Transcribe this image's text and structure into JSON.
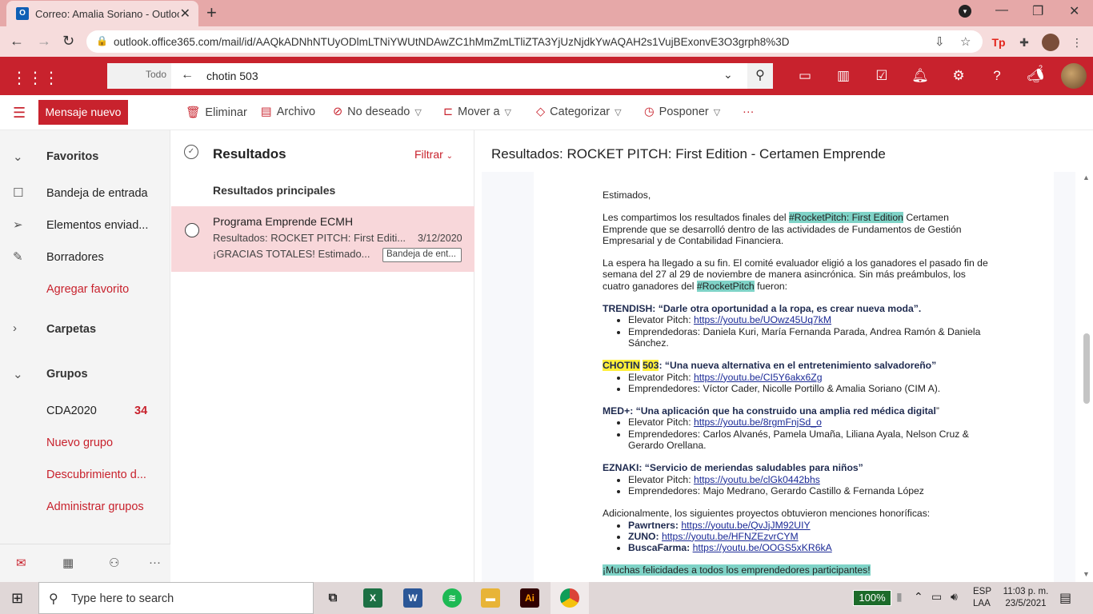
{
  "browser": {
    "tab_title": "Correo: Amalia Soriano - Outlook",
    "url": "outlook.office365.com/mail/id/AAQkADNhNTUyODlmLTNiYWUtNDAwZC1hMmZmLTliZTA3YjUzNjdkYwAQAH2s1VujBExonvE3O3grph8%3D"
  },
  "outlook": {
    "search_scope": "Todo",
    "search_query": "chotin 503",
    "new_message": "Mensaje nuevo",
    "commands": {
      "delete": "Eliminar",
      "archive": "Archivo",
      "junk": "No deseado",
      "move": "Mover a",
      "categorize": "Categorizar",
      "snooze": "Posponer",
      "more": "···"
    },
    "notification_count": "2"
  },
  "nav": {
    "favorites": "Favoritos",
    "inbox": "Bandeja de entrada",
    "sent": "Elementos enviad...",
    "drafts": "Borradores",
    "add_favorite": "Agregar favorito",
    "folders": "Carpetas",
    "groups": "Grupos",
    "group1": "CDA2020",
    "group1_count": "34",
    "new_group": "Nuevo grupo",
    "discover": "Descubrimiento d...",
    "manage": "Administrar grupos"
  },
  "list": {
    "title": "Resultados",
    "filter": "Filtrar",
    "section": "Resultados principales",
    "item": {
      "from": "Programa Emprende ECMH",
      "subject": "Resultados: ROCKET PITCH: First Editi...",
      "date": "3/12/2020",
      "preview": "¡GRACIAS TOTALES! Estimado...",
      "folder": "Bandeja de ent..."
    }
  },
  "reading": {
    "title": "Resultados: ROCKET PITCH: First Edition - Certamen Emprende",
    "greeting": "Estimados,",
    "p1_a": "Les compartimos los resultados finales del ",
    "p1_hl": "#RocketPitch: First Edition",
    "p1_b": " Certamen Emprende que se desarrolló dentro de las actividades de Fundamentos de Gestión Empresarial y de Contabilidad Financiera.",
    "p2_a": "La espera ha llegado a su fin. El comité evaluador eligió a los ganadores el pasado fin de semana del 27 al 29 de noviembre de manera asincrónica. Sin más preámbulos, los cuatro ganadores del ",
    "p2_hl": "#RocketPitch",
    "p2_b": " fueron:",
    "w1_title": "TRENDISH: “Darle otra oportunidad a la ropa, es crear nueva moda”.",
    "w1_pitch_label": "Elevator Pitch: ",
    "w1_pitch_url": "https://youtu.be/UOwz45Uq7kM",
    "w1_team": "Emprendedoras: Daniela Kuri, María Fernanda Parada, Andrea Ramón & Daniela Sánchez.",
    "w2_hl1": "CHOTIN",
    "w2_hl2": "503",
    "w2_title": ": “Una nueva alternativa en el entretenimiento salvadoreño”",
    "w2_pitch_label": "Elevator Pitch: ",
    "w2_pitch_url": "https://youtu.be/CI5Y6akx6Zg",
    "w2_team": "Emprendedores: Víctor Cader, Nicolle Portillo & Amalia Soriano (CIM A).",
    "w3_title": "MED+: “Una aplicación que ha construido una amplia red médica digital",
    "w3_quote": "”",
    "w3_pitch_label": "Elevator Pitch: ",
    "w3_pitch_url": "https://youtu.be/8rgmFnjSd_o",
    "w3_team": "Emprendedores: Carlos Alvanés, Pamela Umaña, Liliana Ayala, Nelson Cruz & Gerardo Orellana.",
    "w4_title": "EZNAKI: “Servicio de meriendas saludables para niños”",
    "w4_pitch_label": "Elevator Pitch: ",
    "w4_pitch_url": "https://youtu.be/clGk0442bhs",
    "w4_team": "Emprendedores: Majo Medrano, Gerardo Castillo & Fernanda López",
    "hon_intro": "Adicionalmente, los siguientes proyectos obtuvieron menciones honoríficas:",
    "hon1_name": "Pawrtners: ",
    "hon1_url": "https://youtu.be/QvJjJM92UIY",
    "hon2_name": "ZUNO: ",
    "hon2_url": "https://youtu.be/HFNZEzvrCYM",
    "hon3_name": "BuscaFarma: ",
    "hon3_url": "https://youtu.be/OOGS5xKR6kA",
    "closing": "¡Muchas felicidades a todos los emprendedores participantes!"
  },
  "taskbar": {
    "search_placeholder": "Type here to search",
    "zoom": "100%",
    "lang1": "ESP",
    "lang2": "LAA",
    "time": "11:03 p. m.",
    "date": "23/5/2021"
  },
  "colors": {
    "accent": "#c8222d",
    "highlight_teal": "#7fd3c7",
    "highlight_yellow": "#ffef3a"
  }
}
